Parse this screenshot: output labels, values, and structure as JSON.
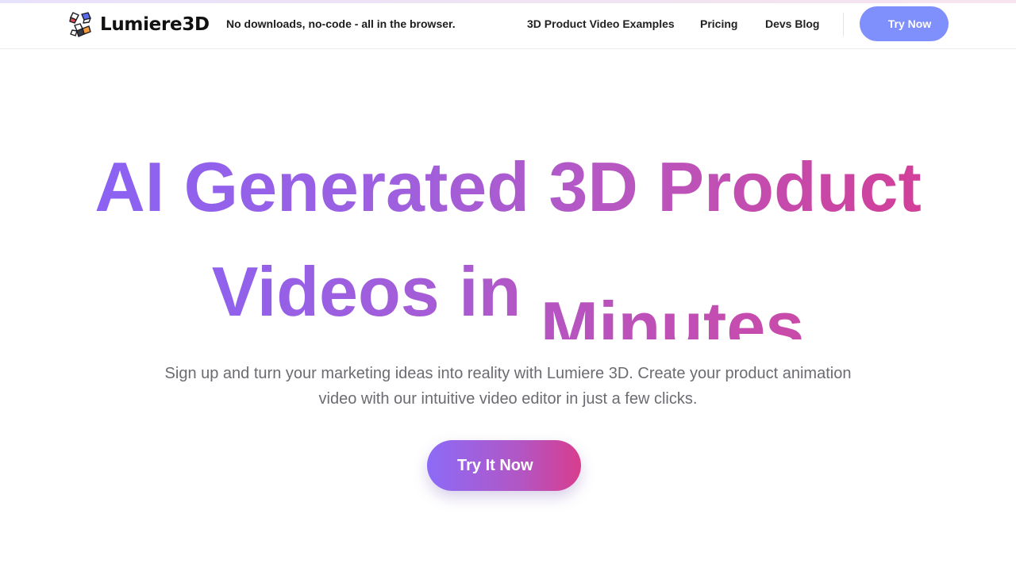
{
  "brand": {
    "name": "Lumiere3D",
    "logo_icon": "cube-cluster-logo-icon",
    "tagline": "No downloads, no-code - all in the browser."
  },
  "nav": {
    "items": [
      {
        "label": "3D Product Video Examples"
      },
      {
        "label": "Pricing"
      },
      {
        "label": "Devs Blog"
      }
    ],
    "cta_label": "Try Now"
  },
  "hero": {
    "title_line1": "AI Generated 3D Product",
    "title_line2_words": [
      "Videos",
      "in",
      "Minutes"
    ],
    "subtitle": "Sign up and turn your marketing ideas into reality with Lumiere 3D. Create your product animation video with our intuitive video editor in just a few clicks.",
    "cta_label": "Try It Now"
  },
  "colors": {
    "accent_purple": "#8c63f2",
    "accent_pink": "#d33d95",
    "nav_button": "#7f8ffb",
    "subtitle_text": "#6b6b72"
  }
}
